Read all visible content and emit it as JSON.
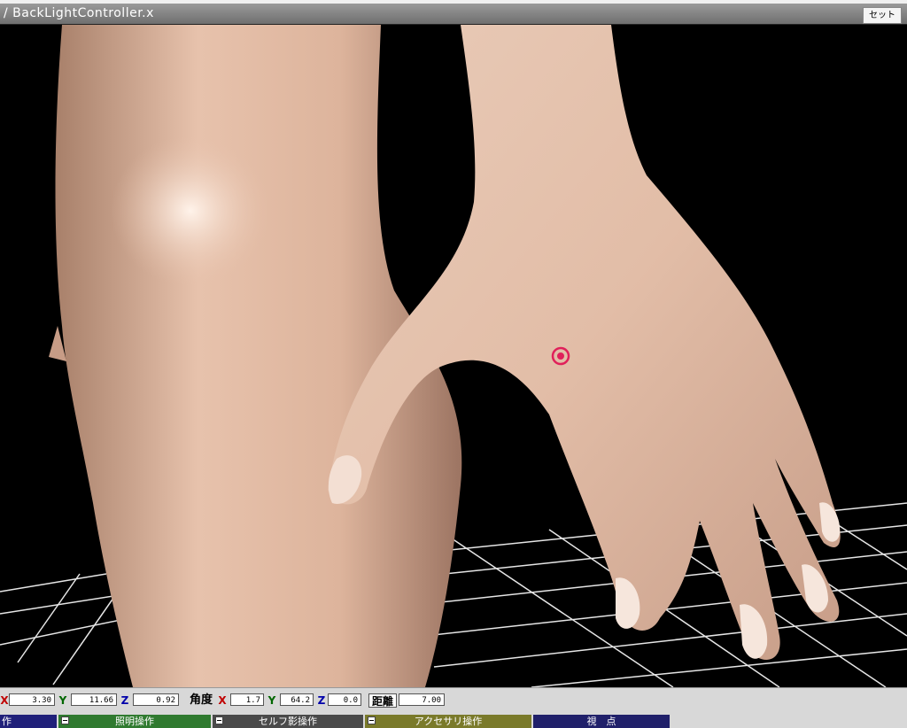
{
  "window": {
    "title": "/ BackLightController.x",
    "set_button": "セット"
  },
  "viewport": {
    "background": "#000000",
    "skin_color": "#e9c3ad",
    "grid_color": "#e6e6e6",
    "marker_color": "#e0205a"
  },
  "position": {
    "x_label": "X",
    "x_value": "3.30",
    "y_label": "Y",
    "y_value": "11.66",
    "z_label": "Z",
    "z_value": "0.92"
  },
  "angle": {
    "label": "角度",
    "x_label": "X",
    "x_value": "1.7",
    "y_label": "Y",
    "y_value": "64.2",
    "z_label": "Z",
    "z_value": "0.0"
  },
  "distance": {
    "label": "距離",
    "value": "7.00"
  },
  "tabs": [
    {
      "label": "作",
      "color": "#20207a"
    },
    {
      "label": "照明操作",
      "color": "#2f7a2f"
    },
    {
      "label": "セルフ影操作",
      "color": "#4a4a4a"
    },
    {
      "label": "アクセサリ操作",
      "color": "#7a7a2a"
    },
    {
      "label": "視　点",
      "color": "#20206a"
    }
  ]
}
